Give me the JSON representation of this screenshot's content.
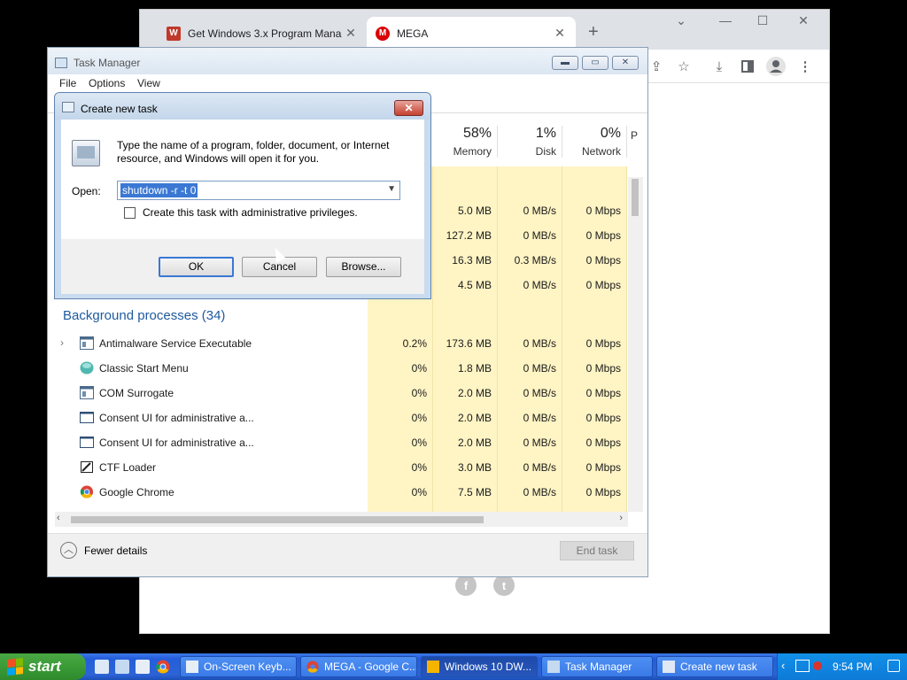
{
  "browser": {
    "tabs": [
      {
        "title": "Get Windows 3.x Program Mana",
        "favicon": "get-windows-favicon"
      },
      {
        "title": "MEGA",
        "favicon": "mega-favicon"
      }
    ],
    "new_tab": "+",
    "window_controls": {
      "dropdown": "⌄",
      "minimize": "—",
      "maximize": "☐",
      "close": "✕"
    },
    "toolbar_icons": [
      "share-icon",
      "star-icon",
      "download-icon",
      "sidepanel-icon",
      "profile-icon",
      "menu-icon"
    ],
    "social": [
      {
        "icon": "facebook-icon",
        "glyph": "f"
      },
      {
        "icon": "twitter-icon",
        "glyph": "t"
      }
    ]
  },
  "task_manager": {
    "title": "Task Manager",
    "menu": [
      "File",
      "Options",
      "View"
    ],
    "columns": [
      {
        "pct": "58%",
        "name": "Memory"
      },
      {
        "pct": "1%",
        "name": "Disk"
      },
      {
        "pct": "0%",
        "name": "Network"
      },
      {
        "pct": "",
        "name": "P"
      }
    ],
    "app_rows": [
      {
        "memory": "5.0 MB",
        "disk": "0 MB/s",
        "network": "0 Mbps"
      },
      {
        "memory": "127.2 MB",
        "disk": "0 MB/s",
        "network": "0 Mbps"
      },
      {
        "memory": "16.3 MB",
        "disk": "0.3 MB/s",
        "network": "0 Mbps"
      },
      {
        "memory": "4.5 MB",
        "disk": "0 MB/s",
        "network": "0 Mbps"
      }
    ],
    "background_header": "Background processes (34)",
    "background_rows": [
      {
        "name": "Antimalware Service Executable",
        "cpu": "0.2%",
        "memory": "173.6 MB",
        "disk": "0 MB/s",
        "network": "0 Mbps",
        "expandable": true
      },
      {
        "name": "Classic Start Menu",
        "cpu": "0%",
        "memory": "1.8 MB",
        "disk": "0 MB/s",
        "network": "0 Mbps"
      },
      {
        "name": "COM Surrogate",
        "cpu": "0%",
        "memory": "2.0 MB",
        "disk": "0 MB/s",
        "network": "0 Mbps"
      },
      {
        "name": "Consent UI for administrative a...",
        "cpu": "0%",
        "memory": "2.0 MB",
        "disk": "0 MB/s",
        "network": "0 Mbps"
      },
      {
        "name": "Consent UI for administrative a...",
        "cpu": "0%",
        "memory": "2.0 MB",
        "disk": "0 MB/s",
        "network": "0 Mbps"
      },
      {
        "name": "CTF Loader",
        "cpu": "0%",
        "memory": "3.0 MB",
        "disk": "0 MB/s",
        "network": "0 Mbps"
      },
      {
        "name": "Google Chrome",
        "cpu": "0%",
        "memory": "7.5 MB",
        "disk": "0 MB/s",
        "network": "0 Mbps"
      }
    ],
    "fewer_details": "Fewer details",
    "end_task": "End task"
  },
  "dialog": {
    "title": "Create new task",
    "close": "✕",
    "description": "Type the name of a program, folder, document, or Internet resource, and Windows will open it for you.",
    "open_label": "Open:",
    "open_value": "shutdown -r -t 0",
    "admin_checkbox": "Create this task with administrative privileges.",
    "ok": "OK",
    "cancel": "Cancel",
    "browse": "Browse..."
  },
  "taskbar": {
    "start": "start",
    "buttons": [
      {
        "label": "On-Screen Keyb...",
        "active": false
      },
      {
        "label": "MEGA - Google C...",
        "active": false
      },
      {
        "label": "Windows 10 DW...",
        "active": true
      },
      {
        "label": "Task Manager",
        "active": false
      },
      {
        "label": "Create new task",
        "active": false
      }
    ],
    "clock": "9:54 PM"
  }
}
